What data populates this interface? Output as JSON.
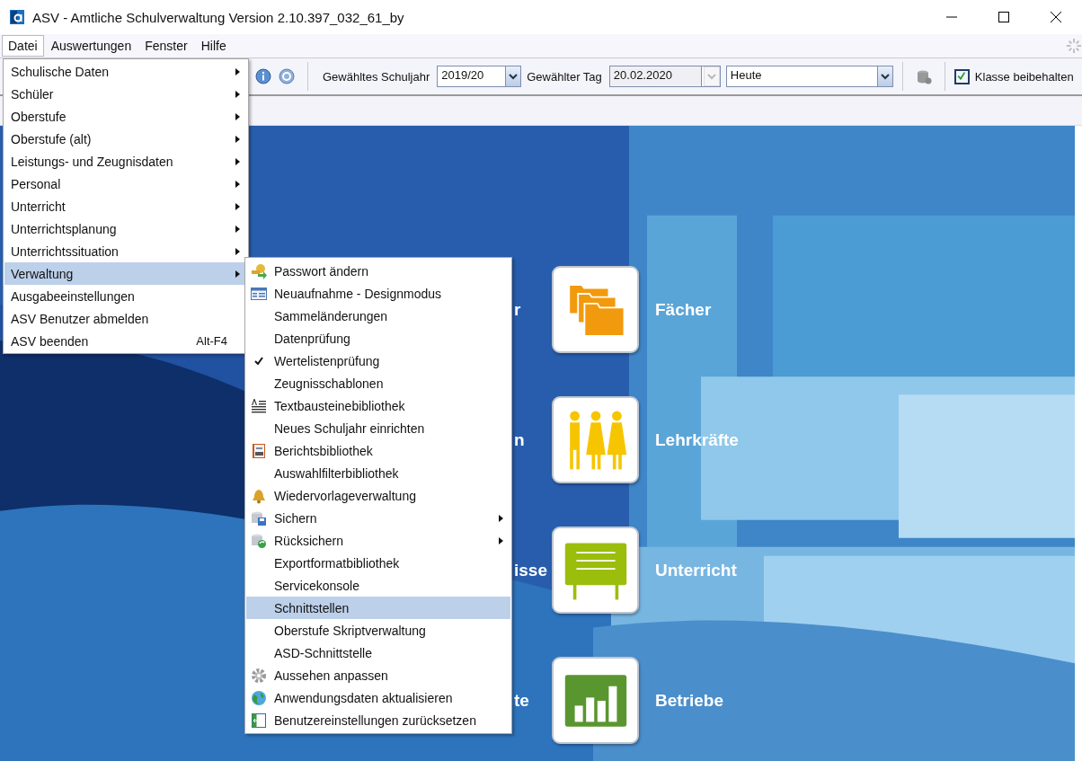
{
  "window": {
    "title": "ASV - Amtliche Schulverwaltung Version 2.10.397_032_61_by"
  },
  "menubar": [
    {
      "label": "Datei",
      "selected": true
    },
    {
      "label": "Auswertungen",
      "selected": false
    },
    {
      "label": "Fenster",
      "selected": false
    },
    {
      "label": "Hilfe",
      "selected": false
    }
  ],
  "toolbar": {
    "schuljahr_label": "Gewähltes Schuljahr",
    "schuljahr": "2019/20",
    "tag_label": "Gewählter Tag",
    "tag": "20.02.2020",
    "tag_disabled": true,
    "ansicht": "Heute",
    "klasse": {
      "label": "Klasse beibehalten",
      "checked": true
    }
  },
  "datei_menu": [
    {
      "label": "Schulische Daten",
      "submenu": true,
      "selected": false
    },
    {
      "label": "Schüler",
      "submenu": true,
      "selected": false
    },
    {
      "label": "Oberstufe",
      "submenu": true,
      "selected": false
    },
    {
      "label": "Oberstufe (alt)",
      "submenu": true,
      "selected": false
    },
    {
      "label": "Leistungs- und Zeugnisdaten",
      "submenu": true,
      "selected": false
    },
    {
      "label": "Personal",
      "submenu": true,
      "selected": false
    },
    {
      "label": "Unterricht",
      "submenu": true,
      "selected": false
    },
    {
      "label": "Unterrichtsplanung",
      "submenu": true,
      "selected": false
    },
    {
      "label": "Unterrichtssituation",
      "submenu": true,
      "selected": false
    },
    {
      "label": "Verwaltung",
      "submenu": true,
      "selected": true
    },
    {
      "label": "Ausgabeeinstellungen",
      "submenu": false,
      "selected": false
    },
    {
      "label": "ASV Benutzer abmelden",
      "submenu": false,
      "selected": false
    },
    {
      "label": "ASV beenden",
      "submenu": false,
      "shortcut": "Alt-F4",
      "selected": false
    }
  ],
  "verwaltung_menu": [
    {
      "label": "Passwort ändern",
      "kind": "key",
      "submenu": false,
      "checked": false,
      "selected": false
    },
    {
      "label": "Neuaufnahme - Designmodus",
      "kind": "form",
      "submenu": false,
      "checked": false,
      "selected": false
    },
    {
      "label": "Sammeländerungen",
      "submenu": false,
      "checked": false,
      "selected": false
    },
    {
      "label": "Datenprüfung",
      "submenu": false,
      "checked": false,
      "selected": false
    },
    {
      "label": "Wertelistenprüfung",
      "submenu": false,
      "checked": true,
      "selected": false
    },
    {
      "label": "Zeugnisschablonen",
      "submenu": false,
      "checked": false,
      "selected": false
    },
    {
      "label": "Textbausteinebibliothek",
      "kind": "text",
      "submenu": false,
      "checked": false,
      "selected": false
    },
    {
      "label": "Neues Schuljahr einrichten",
      "submenu": false,
      "checked": false,
      "selected": false
    },
    {
      "label": "Berichtsbibliothek",
      "kind": "report",
      "submenu": false,
      "checked": false,
      "selected": false
    },
    {
      "label": "Auswahlfilterbibliothek",
      "submenu": false,
      "checked": false,
      "selected": false
    },
    {
      "label": "Wiedervorlageverwaltung",
      "kind": "bell",
      "submenu": false,
      "checked": false,
      "selected": false
    },
    {
      "label": "Sichern",
      "kind": "backup",
      "submenu": true,
      "checked": false,
      "selected": false
    },
    {
      "label": "Rücksichern",
      "kind": "restore",
      "submenu": true,
      "checked": false,
      "selected": false
    },
    {
      "label": "Exportformatbibliothek",
      "submenu": false,
      "checked": false,
      "selected": false
    },
    {
      "label": "Servicekonsole",
      "submenu": false,
      "checked": false,
      "selected": false
    },
    {
      "label": "Schnittstellen",
      "submenu": false,
      "checked": false,
      "selected": true
    },
    {
      "label": "Oberstufe Skriptverwaltung",
      "submenu": false,
      "checked": false,
      "selected": false
    },
    {
      "label": "ASD-Schnittstelle",
      "submenu": false,
      "checked": false,
      "selected": false
    },
    {
      "label": "Aussehen anpassen",
      "kind": "gear",
      "submenu": false,
      "checked": false,
      "selected": false
    },
    {
      "label": "Anwendungsdaten aktualisieren",
      "kind": "globe",
      "submenu": false,
      "checked": false,
      "selected": false
    },
    {
      "label": "Benutzereinstellungen zurücksetzen",
      "kind": "reset",
      "submenu": false,
      "checked": false,
      "selected": false
    }
  ],
  "tiles": [
    {
      "left_label": "r",
      "label": "Fächer",
      "kind": "folders"
    },
    {
      "left_label": "n",
      "label": "Lehrkräfte",
      "kind": "people"
    },
    {
      "left_label": "isse",
      "label": "Unterricht",
      "kind": "board"
    },
    {
      "left_label": "te",
      "label": "Betriebe",
      "kind": "chart"
    }
  ]
}
